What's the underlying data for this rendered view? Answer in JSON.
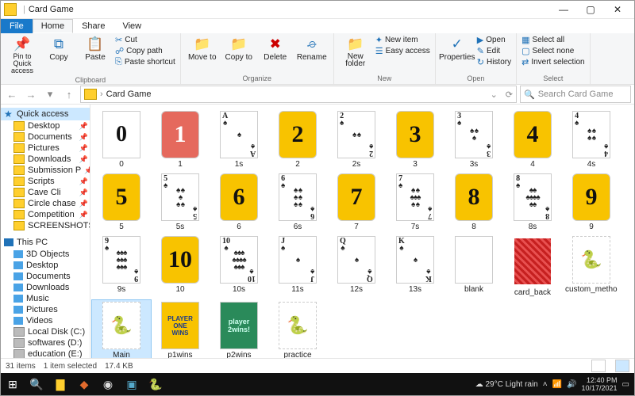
{
  "window": {
    "title": "Card Game"
  },
  "tabs": {
    "file": "File",
    "home": "Home",
    "share": "Share",
    "view": "View"
  },
  "ribbon": {
    "clipboard": {
      "label": "Clipboard",
      "pin": "Pin to Quick access",
      "copy": "Copy",
      "paste": "Paste",
      "cut": "Cut",
      "copypath": "Copy path",
      "pasteshort": "Paste shortcut"
    },
    "organize": {
      "label": "Organize",
      "moveto": "Move to",
      "copyto": "Copy to",
      "delete": "Delete",
      "rename": "Rename"
    },
    "new": {
      "label": "New",
      "newfolder": "New folder",
      "newitem": "New item",
      "easyaccess": "Easy access"
    },
    "open": {
      "label": "Open",
      "properties": "Properties",
      "open": "Open",
      "edit": "Edit",
      "history": "History"
    },
    "select": {
      "label": "Select",
      "all": "Select all",
      "none": "Select none",
      "invert": "Invert selection"
    }
  },
  "address": {
    "path": "Card Game",
    "search_placeholder": "Search Card Game"
  },
  "sidebar": {
    "quick": "Quick access",
    "items1": [
      "Desktop",
      "Documents",
      "Pictures",
      "Downloads",
      "Submission P",
      "Scripts",
      "Cave Cli",
      "Circle chase",
      "Competition",
      "SCREENSHOTS"
    ],
    "thispc": "This PC",
    "items2": [
      "3D Objects",
      "Desktop",
      "Documents",
      "Downloads",
      "Music",
      "Pictures",
      "Videos",
      "Local Disk (C:)",
      "softwares (D:)",
      "education (E:)"
    ]
  },
  "files": [
    {
      "name": "0",
      "kind": "zero",
      "v": "0"
    },
    {
      "name": "1",
      "kind": "num-red",
      "v": "1"
    },
    {
      "name": "1s",
      "kind": "card",
      "rank": "A",
      "pips": "♠"
    },
    {
      "name": "2",
      "kind": "num",
      "v": "2"
    },
    {
      "name": "2s",
      "kind": "card",
      "rank": "2",
      "pips": "♠ ♠"
    },
    {
      "name": "3",
      "kind": "num",
      "v": "3"
    },
    {
      "name": "3s",
      "kind": "card",
      "rank": "3",
      "pips": "♠ ♠\n♠"
    },
    {
      "name": "4",
      "kind": "num",
      "v": "4"
    },
    {
      "name": "4s",
      "kind": "card",
      "rank": "4",
      "pips": "♠ ♠\n♠ ♠"
    },
    {
      "name": "5",
      "kind": "num",
      "v": "5"
    },
    {
      "name": "5s",
      "kind": "card",
      "rank": "5",
      "pips": "♠ ♠\n♠\n♠ ♠"
    },
    {
      "name": "6",
      "kind": "num",
      "v": "6"
    },
    {
      "name": "6s",
      "kind": "card",
      "rank": "6",
      "pips": "♠ ♠\n♠ ♠\n♠ ♠"
    },
    {
      "name": "7",
      "kind": "num",
      "v": "7"
    },
    {
      "name": "7s",
      "kind": "card",
      "rank": "7",
      "pips": "♠ ♠\n♠♠♠\n♠ ♠"
    },
    {
      "name": "8",
      "kind": "num",
      "v": "8"
    },
    {
      "name": "8s",
      "kind": "card",
      "rank": "8",
      "pips": "♠♠\n♠♠♠♠\n♠♠"
    },
    {
      "name": "9",
      "kind": "num",
      "v": "9"
    },
    {
      "name": "9s",
      "kind": "card",
      "rank": "9",
      "pips": "♠♠♠\n♠♠♠\n♠♠♠"
    },
    {
      "name": "10",
      "kind": "num",
      "v": "10"
    },
    {
      "name": "10s",
      "kind": "card",
      "rank": "10",
      "pips": "♠♠♠\n♠♠♠♠\n♠♠♠"
    },
    {
      "name": "11s",
      "kind": "card",
      "rank": "J",
      "pips": "♠"
    },
    {
      "name": "12s",
      "kind": "card",
      "rank": "Q",
      "pips": "♠"
    },
    {
      "name": "13s",
      "kind": "card",
      "rank": "K",
      "pips": "♠"
    },
    {
      "name": "blank",
      "kind": "blank"
    },
    {
      "name": "card_back",
      "kind": "back"
    },
    {
      "name": "custom_method_test",
      "kind": "py"
    },
    {
      "name": "Main",
      "kind": "py",
      "selected": true
    },
    {
      "name": "p1wins",
      "kind": "p1",
      "v": "PLAYER\nONE\nWINS"
    },
    {
      "name": "p2wins",
      "kind": "p2",
      "v": "player\n2wins!"
    },
    {
      "name": "practice",
      "kind": "py"
    }
  ],
  "status": {
    "count": "31 items",
    "selected": "1 item selected",
    "size": "17.4 KB"
  },
  "tray": {
    "weather": "29°C  Light rain",
    "time": "12:40 PM",
    "date": "10/17/2021"
  }
}
